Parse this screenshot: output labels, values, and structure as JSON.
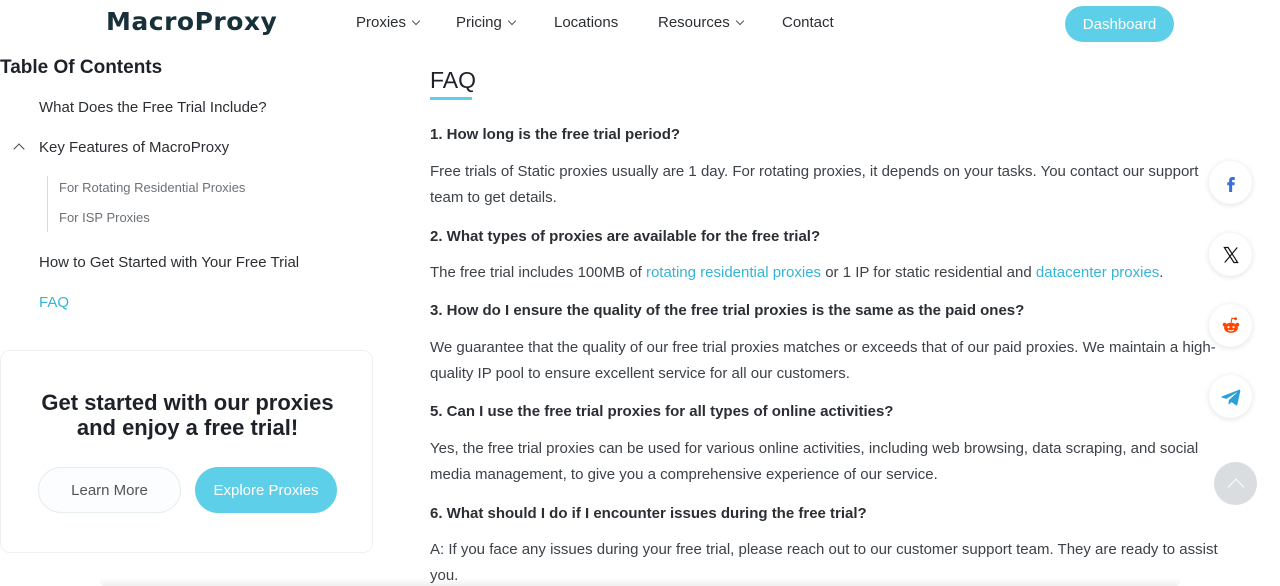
{
  "header": {
    "logo": "MacroProxy",
    "nav": [
      {
        "label": "Proxies",
        "has_dropdown": true
      },
      {
        "label": "Pricing",
        "has_dropdown": true
      },
      {
        "label": "Locations",
        "has_dropdown": false
      },
      {
        "label": "Resources",
        "has_dropdown": true
      },
      {
        "label": "Contact",
        "has_dropdown": false
      }
    ],
    "dashboard_label": "Dashboard"
  },
  "toc": {
    "title": "Table Of Contents",
    "items": [
      "What Does the Free Trial Include?",
      "Key Features of MacroProxy",
      "How to Get Started with Your Free Trial",
      "FAQ"
    ],
    "subitems": [
      "For Rotating Residential Proxies",
      "For ISP Proxies"
    ],
    "active": "FAQ"
  },
  "promo": {
    "title_line1": "Get started with our proxies",
    "title_line2": "and enjoy a free trial",
    "title_suffix": "!",
    "learn_more": "Learn More",
    "explore": "Explore Proxies"
  },
  "faq": {
    "heading": "FAQ",
    "q1": "1. How long is the free trial period?",
    "a1": "Free trials of Static proxies usually are 1 day. For rotating proxies, it depends on your tasks. You contact our support team to get details.",
    "q2": "2. What types of proxies are available for the free trial?",
    "a2_part1": "The free trial includes 100MB of ",
    "a2_link1": "rotating residential proxies",
    "a2_part2": " or 1 IP for static residential and ",
    "a2_link2": "datacenter proxies",
    "a2_part3": ".",
    "q3": "3. How do I ensure the quality of the free trial proxies is the same as the paid ones?",
    "a3": "We guarantee that the quality of our free trial proxies matches or exceeds that of our paid proxies. We maintain a high-quality IP pool to ensure excellent service for all our customers.",
    "q5": "5. Can I use the free trial proxies for all types of online activities?",
    "a5": "Yes, the free trial proxies can be used for various online activities, including web browsing, data scraping, and social media management, to give you a comprehensive experience of our service.",
    "q6": "6. What should I do if I encounter issues during the free trial?",
    "a6": "A: If you face any issues during your free trial, please reach out to our customer support team. They are ready to assist you."
  },
  "social": [
    "facebook-icon",
    "x-icon",
    "reddit-icon",
    "telegram-icon"
  ],
  "colors": {
    "accent": "#5ecfe8",
    "link": "#34b5d8",
    "text": "#2b2f33"
  }
}
